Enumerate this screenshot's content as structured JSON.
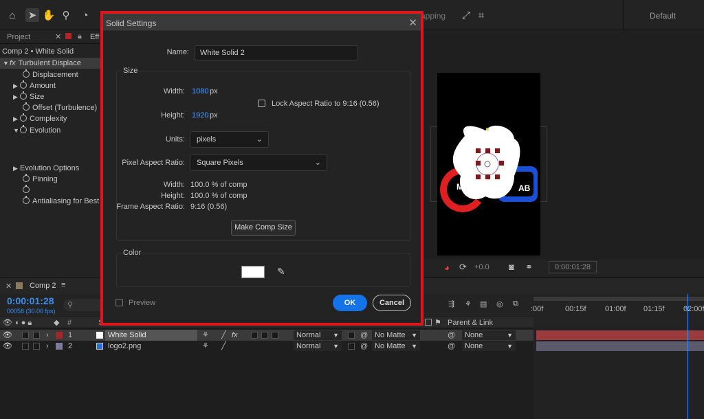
{
  "toolbar": {
    "tools": [
      "home-icon",
      "selection-icon",
      "hand-icon",
      "zoom-icon",
      "camera-icon"
    ],
    "snapping_label": "apping",
    "workspace": "Default"
  },
  "left_panel": {
    "tab_project": "Project",
    "tab_effects": "Eff",
    "breadcrumb": "Comp 2 • White Solid",
    "effect_name": "Turbulent Displace",
    "properties": [
      {
        "label": "Displacement",
        "twirl": false
      },
      {
        "label": "Amount",
        "twirl": true
      },
      {
        "label": "Size",
        "twirl": true
      },
      {
        "label": "Offset (Turbulence)",
        "twirl": false
      },
      {
        "label": "Complexity",
        "twirl": true
      },
      {
        "label": "Evolution",
        "twirl": true,
        "open": true
      }
    ],
    "evolution_options": "Evolution Options",
    "pinning": "Pinning",
    "antialiasing": "Antialiasing for Best C"
  },
  "viewer": {
    "zoom_value": "+0.0",
    "timecode": "0:00:01:28",
    "logo_text_left": "M",
    "logo_text_right": "AB"
  },
  "dialog": {
    "title": "Solid Settings",
    "name_label": "Name:",
    "name_value": "White Solid 2",
    "size_group": "Size",
    "width_label": "Width:",
    "width_value": "1080",
    "width_unit": "px",
    "height_label": "Height:",
    "height_value": "1920",
    "height_unit": "px",
    "lock_label": "Lock Aspect Ratio to 9:16 (0.56)",
    "lock_checked": false,
    "units_label": "Units:",
    "units_value": "pixels",
    "par_label": "Pixel Aspect Ratio:",
    "par_value": "Square Pixels",
    "info_width_label": "Width:",
    "info_width_value": "100.0 % of comp",
    "info_height_label": "Height:",
    "info_height_value": "100.0 % of comp",
    "far_label": "Frame Aspect Ratio:",
    "far_value": "9:16 (0.56)",
    "make_comp_size": "Make Comp Size",
    "color_group": "Color",
    "color_value": "#ffffff",
    "preview_label": "Preview",
    "preview_checked": false,
    "ok_label": "OK",
    "cancel_label": "Cancel"
  },
  "timeline": {
    "comp_tab": "Comp 2",
    "timecode": "0:00:01:28",
    "frames": "00058 (30.00 fps)",
    "search_placeholder": "",
    "col_hash": "#",
    "col_source": "S",
    "col_parent": "Parent & Link",
    "ruler_ticks": [
      ":00f",
      "00:15f",
      "01:00f",
      "01:15f",
      "02:00f"
    ],
    "layers": [
      {
        "num": "1",
        "name": "White Solid",
        "mode": "Normal",
        "matte": "No Matte",
        "parent": "None",
        "label_color": "#9c2a2a",
        "selected": true
      },
      {
        "num": "2",
        "name": "logo2.png",
        "mode": "Normal",
        "matte": "No Matte",
        "parent": "None",
        "label_color": "#7a7a9a",
        "selected": false
      }
    ]
  },
  "colors": {
    "accent": "#1473e6",
    "highlight_frame": "#e1161c",
    "value_blue": "#4e9cf5"
  }
}
